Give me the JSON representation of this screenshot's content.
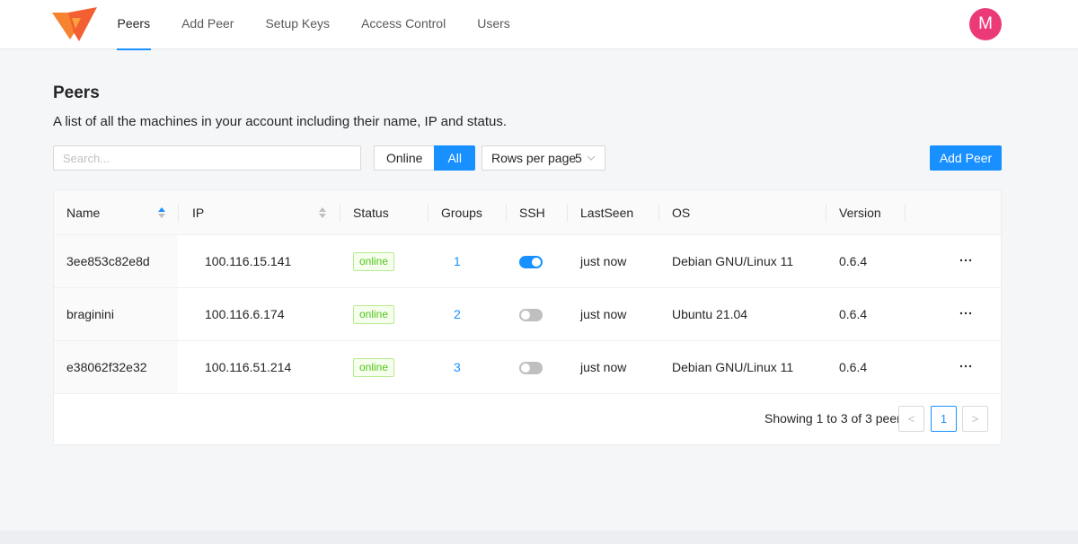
{
  "nav": {
    "items": [
      {
        "label": "Peers",
        "active": true
      },
      {
        "label": "Add Peer"
      },
      {
        "label": "Setup Keys"
      },
      {
        "label": "Access Control"
      },
      {
        "label": "Users"
      }
    ],
    "avatar_letter": "M",
    "avatar_color": "#ec3a78",
    "logo_colors": [
      "#f68330",
      "#f35e32"
    ]
  },
  "page": {
    "title": "Peers",
    "description": "A list of all the machines in your account including their name, IP and status."
  },
  "toolbar": {
    "search_placeholder": "Search...",
    "filter_online": "Online",
    "filter_all": "All",
    "filter_selected": "All",
    "rows_label": "Rows per page",
    "rows_value": "5",
    "add_peer_label": "Add Peer"
  },
  "table": {
    "columns": [
      "Name",
      "IP",
      "Status",
      "Groups",
      "SSH",
      "LastSeen",
      "OS",
      "Version"
    ],
    "rows": [
      {
        "name": "3ee853c82e8d",
        "ip": "100.116.15.141",
        "status": "online",
        "groups": "1",
        "ssh": true,
        "last_seen": "just now",
        "os": "Debian GNU/Linux 11",
        "version": "0.6.4"
      },
      {
        "name": "braginini",
        "ip": "100.116.6.174",
        "status": "online",
        "groups": "2",
        "ssh": false,
        "last_seen": "just now",
        "os": "Ubuntu 21.04",
        "version": "0.6.4"
      },
      {
        "name": "e38062f32e32",
        "ip": "100.116.51.214",
        "status": "online",
        "groups": "3",
        "ssh": false,
        "last_seen": "just now",
        "os": "Debian GNU/Linux 11",
        "version": "0.6.4"
      }
    ],
    "more_icon": "ellipsis-icon"
  },
  "pagination": {
    "summary": "Showing 1 to 3 of 3 peers",
    "prev": "<",
    "current_page": "1",
    "next": ">"
  },
  "accent": "#1890ff",
  "status_color": "#52c41a"
}
